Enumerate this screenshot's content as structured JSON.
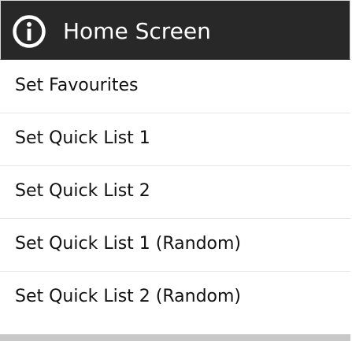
{
  "title": {
    "text": "Home Screen",
    "icon": "info-icon",
    "background": "#282828",
    "text_color": "#ffffff"
  },
  "items": [
    {
      "label": "Set Favourites"
    },
    {
      "label": "Set Quick List 1"
    },
    {
      "label": "Set Quick List 2"
    },
    {
      "label": "Set Quick List 1 (Random)"
    },
    {
      "label": "Set Quick List 2 (Random)"
    }
  ]
}
